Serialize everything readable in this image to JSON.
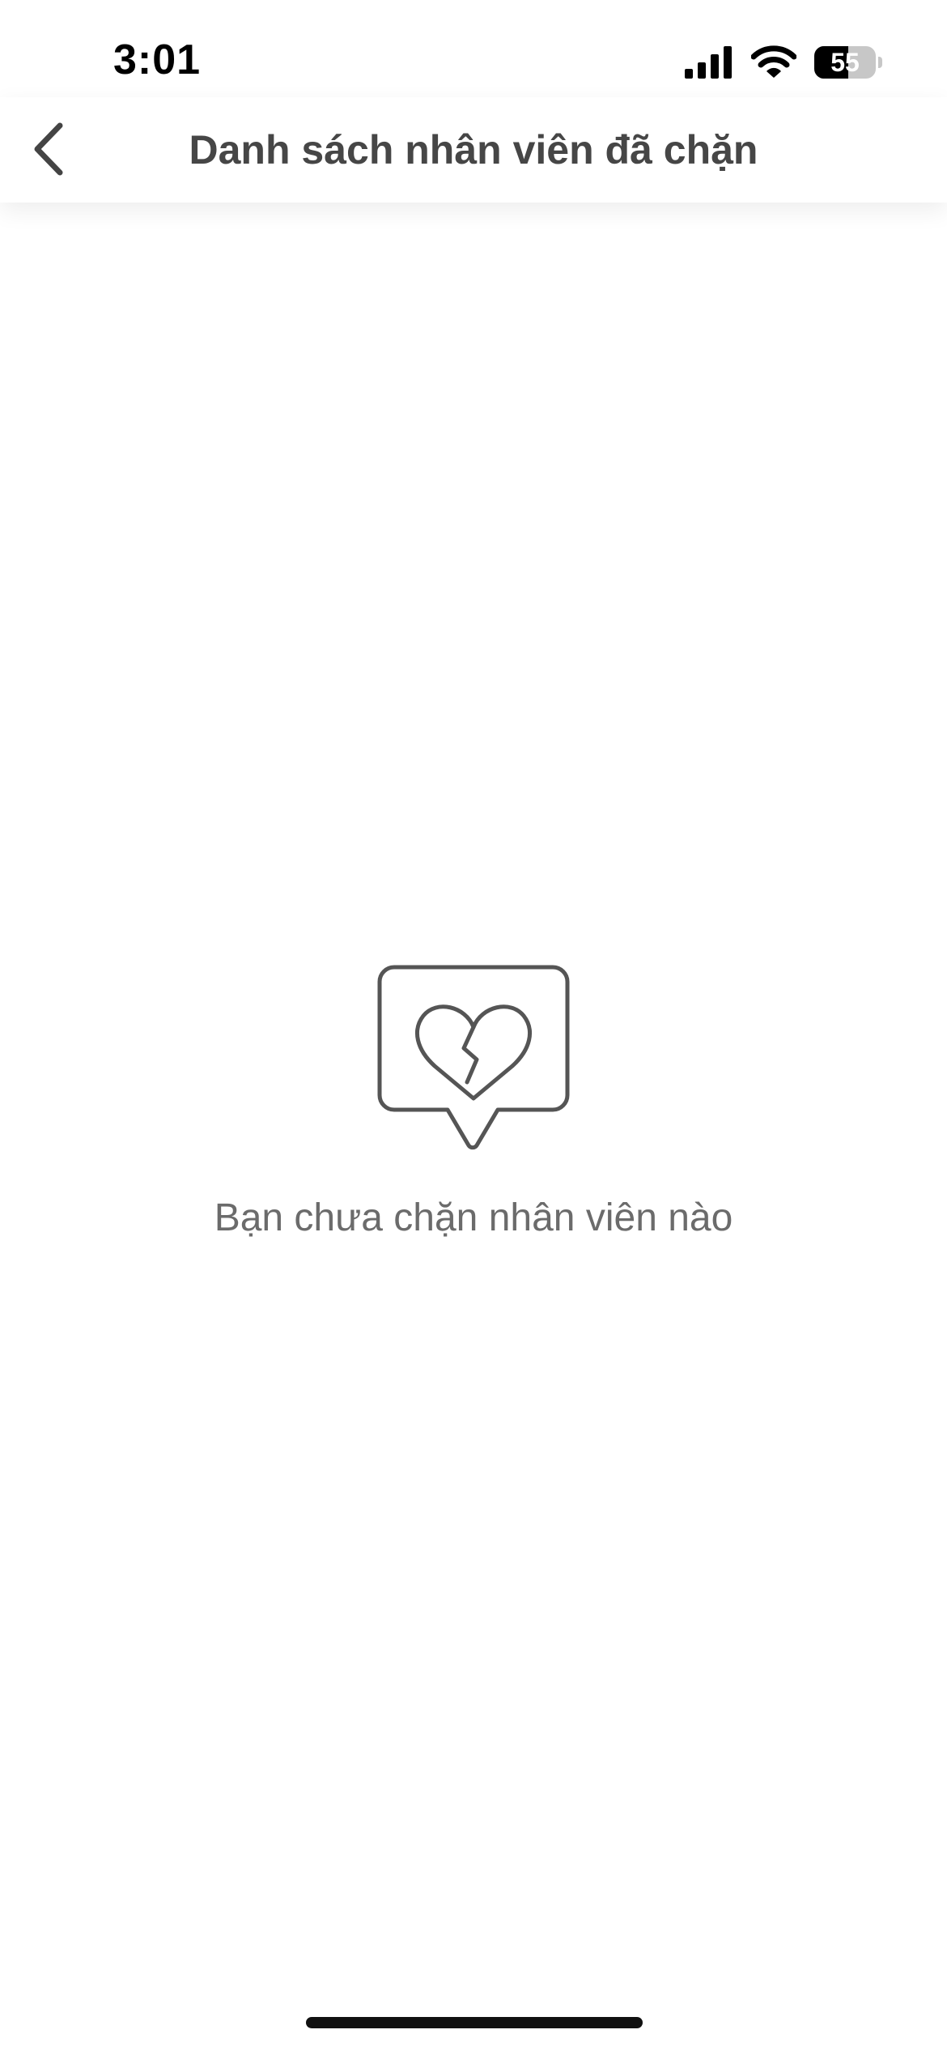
{
  "status_bar": {
    "time": "3:01",
    "battery_level": "55",
    "battery_fraction": 0.55
  },
  "header": {
    "title": "Danh sách nhân viên đã chặn"
  },
  "empty_state": {
    "message": "Bạn chưa chặn nhân viên nào",
    "icon": "broken-heart-chat-icon"
  },
  "colors": {
    "title_text": "#464646",
    "message_text": "#6b6b6b",
    "icon_stroke": "#555555",
    "background": "#ffffff"
  }
}
